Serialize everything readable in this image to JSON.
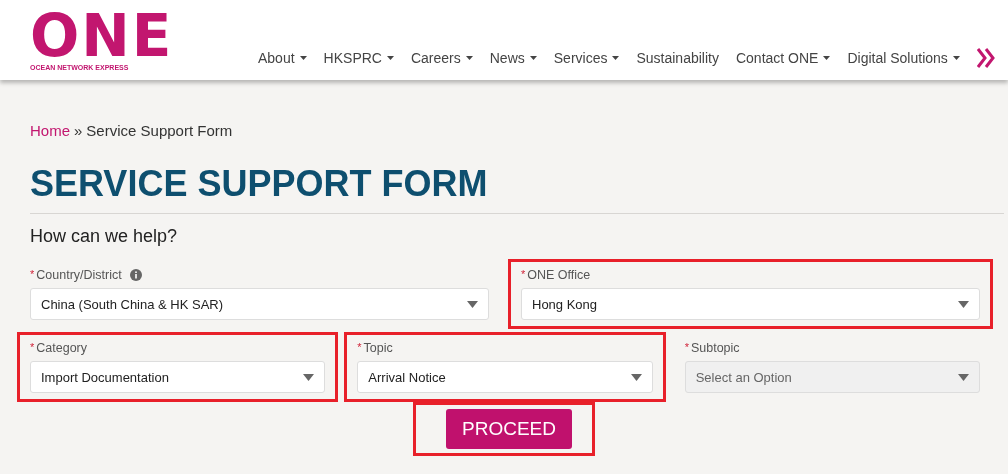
{
  "logo": {
    "wordmark": "ONE",
    "tagline": "OCEAN NETWORK EXPRESS"
  },
  "nav": {
    "items": [
      {
        "label": "About",
        "dropdown": true
      },
      {
        "label": "HKSPRC",
        "dropdown": true
      },
      {
        "label": "Careers",
        "dropdown": true
      },
      {
        "label": "News",
        "dropdown": true
      },
      {
        "label": "Services",
        "dropdown": true
      },
      {
        "label": "Sustainability",
        "dropdown": false
      },
      {
        "label": "Contact ONE",
        "dropdown": true
      },
      {
        "label": "Digital Solutions",
        "dropdown": true
      }
    ]
  },
  "breadcrumb": {
    "home": "Home",
    "separator": "»",
    "current": "Service Support Form"
  },
  "title": "SERVICE SUPPORT FORM",
  "subtitle": "How can we help?",
  "rows": [
    [
      {
        "label": "Country/District",
        "required_mark": "*",
        "info": true,
        "value": "China (South China & HK SAR)",
        "disabled": false,
        "highlighted": false
      },
      {
        "label": "ONE Office",
        "required_mark": "*",
        "info": false,
        "value": "Hong Kong",
        "disabled": false,
        "highlighted": true
      }
    ],
    [
      {
        "label": "Category",
        "required_mark": "*",
        "info": false,
        "value": "Import Documentation",
        "disabled": false,
        "highlighted": true
      },
      {
        "label": "Topic",
        "required_mark": "*",
        "info": false,
        "value": "Arrival Notice",
        "disabled": false,
        "highlighted": true
      },
      {
        "label": "Subtopic",
        "required_mark": "*",
        "info": false,
        "placeholder": "Select an Option",
        "disabled": true,
        "highlighted": false
      }
    ]
  ],
  "proceed": {
    "label": "PROCEED",
    "highlighted": true
  }
}
